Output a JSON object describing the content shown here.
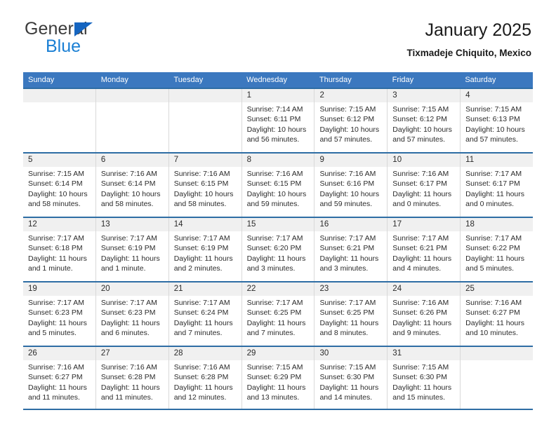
{
  "brand": {
    "line1": "General",
    "line2": "Blue",
    "triangle_color": "#1565c0",
    "blue_text_color": "#1a7fd4"
  },
  "header": {
    "title": "January 2025",
    "subtitle": "Tixmadeje Chiquito, Mexico"
  },
  "theme": {
    "header_bar_color": "#3b78bf",
    "row_rule_color": "#2e6da4",
    "day_band_color": "#f0f0f0"
  },
  "calendar": {
    "weekday_headers": [
      "Sunday",
      "Monday",
      "Tuesday",
      "Wednesday",
      "Thursday",
      "Friday",
      "Saturday"
    ],
    "weeks": [
      [
        {
          "day": "",
          "sunrise": "",
          "sunset": "",
          "daylight1": "",
          "daylight2": ""
        },
        {
          "day": "",
          "sunrise": "",
          "sunset": "",
          "daylight1": "",
          "daylight2": ""
        },
        {
          "day": "",
          "sunrise": "",
          "sunset": "",
          "daylight1": "",
          "daylight2": ""
        },
        {
          "day": "1",
          "sunrise": "Sunrise: 7:14 AM",
          "sunset": "Sunset: 6:11 PM",
          "daylight1": "Daylight: 10 hours",
          "daylight2": "and 56 minutes."
        },
        {
          "day": "2",
          "sunrise": "Sunrise: 7:15 AM",
          "sunset": "Sunset: 6:12 PM",
          "daylight1": "Daylight: 10 hours",
          "daylight2": "and 57 minutes."
        },
        {
          "day": "3",
          "sunrise": "Sunrise: 7:15 AM",
          "sunset": "Sunset: 6:12 PM",
          "daylight1": "Daylight: 10 hours",
          "daylight2": "and 57 minutes."
        },
        {
          "day": "4",
          "sunrise": "Sunrise: 7:15 AM",
          "sunset": "Sunset: 6:13 PM",
          "daylight1": "Daylight: 10 hours",
          "daylight2": "and 57 minutes."
        }
      ],
      [
        {
          "day": "5",
          "sunrise": "Sunrise: 7:15 AM",
          "sunset": "Sunset: 6:14 PM",
          "daylight1": "Daylight: 10 hours",
          "daylight2": "and 58 minutes."
        },
        {
          "day": "6",
          "sunrise": "Sunrise: 7:16 AM",
          "sunset": "Sunset: 6:14 PM",
          "daylight1": "Daylight: 10 hours",
          "daylight2": "and 58 minutes."
        },
        {
          "day": "7",
          "sunrise": "Sunrise: 7:16 AM",
          "sunset": "Sunset: 6:15 PM",
          "daylight1": "Daylight: 10 hours",
          "daylight2": "and 58 minutes."
        },
        {
          "day": "8",
          "sunrise": "Sunrise: 7:16 AM",
          "sunset": "Sunset: 6:15 PM",
          "daylight1": "Daylight: 10 hours",
          "daylight2": "and 59 minutes."
        },
        {
          "day": "9",
          "sunrise": "Sunrise: 7:16 AM",
          "sunset": "Sunset: 6:16 PM",
          "daylight1": "Daylight: 10 hours",
          "daylight2": "and 59 minutes."
        },
        {
          "day": "10",
          "sunrise": "Sunrise: 7:16 AM",
          "sunset": "Sunset: 6:17 PM",
          "daylight1": "Daylight: 11 hours",
          "daylight2": "and 0 minutes."
        },
        {
          "day": "11",
          "sunrise": "Sunrise: 7:17 AM",
          "sunset": "Sunset: 6:17 PM",
          "daylight1": "Daylight: 11 hours",
          "daylight2": "and 0 minutes."
        }
      ],
      [
        {
          "day": "12",
          "sunrise": "Sunrise: 7:17 AM",
          "sunset": "Sunset: 6:18 PM",
          "daylight1": "Daylight: 11 hours",
          "daylight2": "and 1 minute."
        },
        {
          "day": "13",
          "sunrise": "Sunrise: 7:17 AM",
          "sunset": "Sunset: 6:19 PM",
          "daylight1": "Daylight: 11 hours",
          "daylight2": "and 1 minute."
        },
        {
          "day": "14",
          "sunrise": "Sunrise: 7:17 AM",
          "sunset": "Sunset: 6:19 PM",
          "daylight1": "Daylight: 11 hours",
          "daylight2": "and 2 minutes."
        },
        {
          "day": "15",
          "sunrise": "Sunrise: 7:17 AM",
          "sunset": "Sunset: 6:20 PM",
          "daylight1": "Daylight: 11 hours",
          "daylight2": "and 3 minutes."
        },
        {
          "day": "16",
          "sunrise": "Sunrise: 7:17 AM",
          "sunset": "Sunset: 6:21 PM",
          "daylight1": "Daylight: 11 hours",
          "daylight2": "and 3 minutes."
        },
        {
          "day": "17",
          "sunrise": "Sunrise: 7:17 AM",
          "sunset": "Sunset: 6:21 PM",
          "daylight1": "Daylight: 11 hours",
          "daylight2": "and 4 minutes."
        },
        {
          "day": "18",
          "sunrise": "Sunrise: 7:17 AM",
          "sunset": "Sunset: 6:22 PM",
          "daylight1": "Daylight: 11 hours",
          "daylight2": "and 5 minutes."
        }
      ],
      [
        {
          "day": "19",
          "sunrise": "Sunrise: 7:17 AM",
          "sunset": "Sunset: 6:23 PM",
          "daylight1": "Daylight: 11 hours",
          "daylight2": "and 5 minutes."
        },
        {
          "day": "20",
          "sunrise": "Sunrise: 7:17 AM",
          "sunset": "Sunset: 6:23 PM",
          "daylight1": "Daylight: 11 hours",
          "daylight2": "and 6 minutes."
        },
        {
          "day": "21",
          "sunrise": "Sunrise: 7:17 AM",
          "sunset": "Sunset: 6:24 PM",
          "daylight1": "Daylight: 11 hours",
          "daylight2": "and 7 minutes."
        },
        {
          "day": "22",
          "sunrise": "Sunrise: 7:17 AM",
          "sunset": "Sunset: 6:25 PM",
          "daylight1": "Daylight: 11 hours",
          "daylight2": "and 7 minutes."
        },
        {
          "day": "23",
          "sunrise": "Sunrise: 7:17 AM",
          "sunset": "Sunset: 6:25 PM",
          "daylight1": "Daylight: 11 hours",
          "daylight2": "and 8 minutes."
        },
        {
          "day": "24",
          "sunrise": "Sunrise: 7:16 AM",
          "sunset": "Sunset: 6:26 PM",
          "daylight1": "Daylight: 11 hours",
          "daylight2": "and 9 minutes."
        },
        {
          "day": "25",
          "sunrise": "Sunrise: 7:16 AM",
          "sunset": "Sunset: 6:27 PM",
          "daylight1": "Daylight: 11 hours",
          "daylight2": "and 10 minutes."
        }
      ],
      [
        {
          "day": "26",
          "sunrise": "Sunrise: 7:16 AM",
          "sunset": "Sunset: 6:27 PM",
          "daylight1": "Daylight: 11 hours",
          "daylight2": "and 11 minutes."
        },
        {
          "day": "27",
          "sunrise": "Sunrise: 7:16 AM",
          "sunset": "Sunset: 6:28 PM",
          "daylight1": "Daylight: 11 hours",
          "daylight2": "and 11 minutes."
        },
        {
          "day": "28",
          "sunrise": "Sunrise: 7:16 AM",
          "sunset": "Sunset: 6:28 PM",
          "daylight1": "Daylight: 11 hours",
          "daylight2": "and 12 minutes."
        },
        {
          "day": "29",
          "sunrise": "Sunrise: 7:15 AM",
          "sunset": "Sunset: 6:29 PM",
          "daylight1": "Daylight: 11 hours",
          "daylight2": "and 13 minutes."
        },
        {
          "day": "30",
          "sunrise": "Sunrise: 7:15 AM",
          "sunset": "Sunset: 6:30 PM",
          "daylight1": "Daylight: 11 hours",
          "daylight2": "and 14 minutes."
        },
        {
          "day": "31",
          "sunrise": "Sunrise: 7:15 AM",
          "sunset": "Sunset: 6:30 PM",
          "daylight1": "Daylight: 11 hours",
          "daylight2": "and 15 minutes."
        },
        {
          "day": "",
          "sunrise": "",
          "sunset": "",
          "daylight1": "",
          "daylight2": ""
        }
      ]
    ]
  }
}
